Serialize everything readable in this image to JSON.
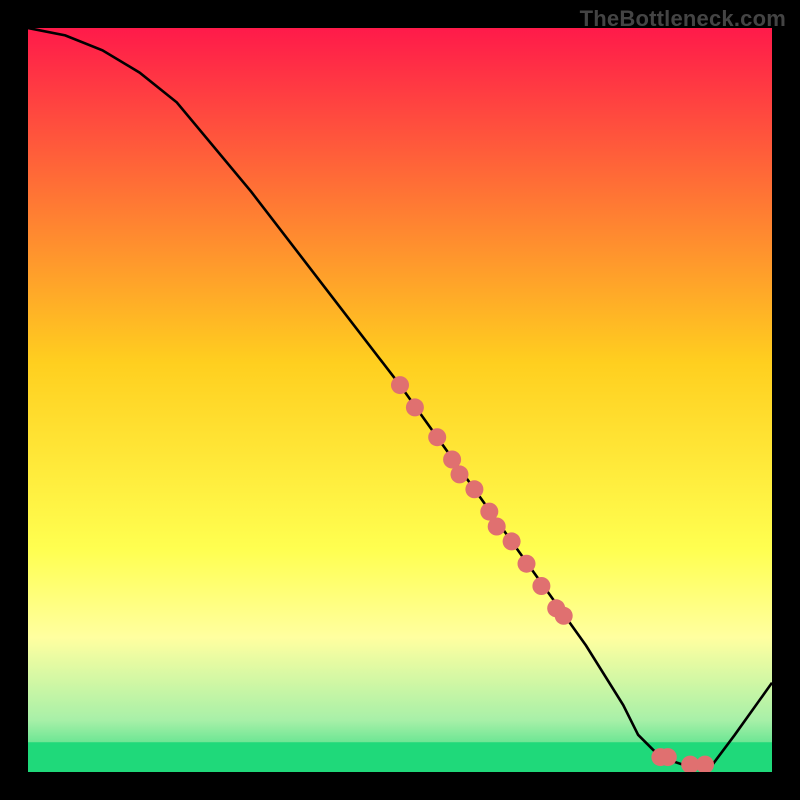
{
  "watermark": "TheBottleneck.com",
  "chart_data": {
    "type": "line",
    "title": "",
    "xlabel": "",
    "ylabel": "",
    "xlim": [
      0,
      100
    ],
    "ylim": [
      0,
      100
    ],
    "grid": false,
    "legend": false,
    "background_gradient_stops": [
      {
        "pos": 0.0,
        "color": "#ff1a4a"
      },
      {
        "pos": 0.45,
        "color": "#ffcf1f"
      },
      {
        "pos": 0.7,
        "color": "#ffff50"
      },
      {
        "pos": 0.82,
        "color": "#ffffa0"
      },
      {
        "pos": 0.93,
        "color": "#a8f0a8"
      },
      {
        "pos": 1.0,
        "color": "#1fd97a"
      }
    ],
    "green_band": {
      "y_from": 0,
      "y_to": 4
    },
    "series": [
      {
        "name": "curve",
        "x": [
          0,
          5,
          10,
          15,
          20,
          30,
          40,
          50,
          55,
          60,
          65,
          70,
          75,
          80,
          82,
          85,
          88,
          90,
          92,
          95,
          100
        ],
        "y": [
          100,
          99,
          97,
          94,
          90,
          78,
          65,
          52,
          45,
          38,
          31,
          24,
          17,
          9,
          5,
          2,
          1,
          1,
          1,
          5,
          12
        ]
      }
    ],
    "points": [
      {
        "x": 50,
        "y": 52
      },
      {
        "x": 52,
        "y": 49
      },
      {
        "x": 55,
        "y": 45
      },
      {
        "x": 57,
        "y": 42
      },
      {
        "x": 58,
        "y": 40
      },
      {
        "x": 60,
        "y": 38
      },
      {
        "x": 62,
        "y": 35
      },
      {
        "x": 63,
        "y": 33
      },
      {
        "x": 65,
        "y": 31
      },
      {
        "x": 67,
        "y": 28
      },
      {
        "x": 69,
        "y": 25
      },
      {
        "x": 71,
        "y": 22
      },
      {
        "x": 72,
        "y": 21
      },
      {
        "x": 85,
        "y": 2
      },
      {
        "x": 86,
        "y": 2
      },
      {
        "x": 89,
        "y": 1
      },
      {
        "x": 91,
        "y": 1
      }
    ],
    "point_style": {
      "radius": 9,
      "fill": "#e07070"
    }
  }
}
